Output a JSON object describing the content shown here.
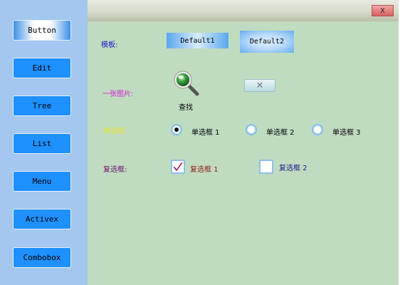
{
  "sidebar": {
    "buttons": [
      {
        "label": "Button",
        "active": true
      },
      {
        "label": "Edit"
      },
      {
        "label": "Tree"
      },
      {
        "label": "List"
      },
      {
        "label": "Menu"
      },
      {
        "label": "Activex"
      },
      {
        "label": "Combobox"
      }
    ]
  },
  "titlebar": {
    "close_label": "X"
  },
  "template_row": {
    "label": "模板:",
    "button1": "Default1",
    "button2": "Default2"
  },
  "image_row": {
    "label": "一张图片:",
    "search_label": "查找",
    "close_glyph": "✕"
  },
  "radio_row": {
    "label": "单选框:",
    "options": [
      {
        "label": "单选框 1",
        "selected": true
      },
      {
        "label": "单选框 2",
        "selected": false
      },
      {
        "label": "单选框 3",
        "selected": false
      }
    ]
  },
  "checkbox_row": {
    "label": "复选框:",
    "options": [
      {
        "label": "复选框 1",
        "checked": true
      },
      {
        "label": "复选框 2",
        "checked": false
      }
    ]
  },
  "colors": {
    "sidebar_bg": "#a3c7ee",
    "main_bg": "#c0dcc0",
    "nav_button": "#1e90ff",
    "template_label": "#1515c8",
    "image_label": "#d81bd8",
    "radio_label": "#e6e62a",
    "checkbox_label": "#6a0f6a",
    "checkbox1_text": "#8b1a1a",
    "checkbox2_text": "#1a1a8b"
  }
}
